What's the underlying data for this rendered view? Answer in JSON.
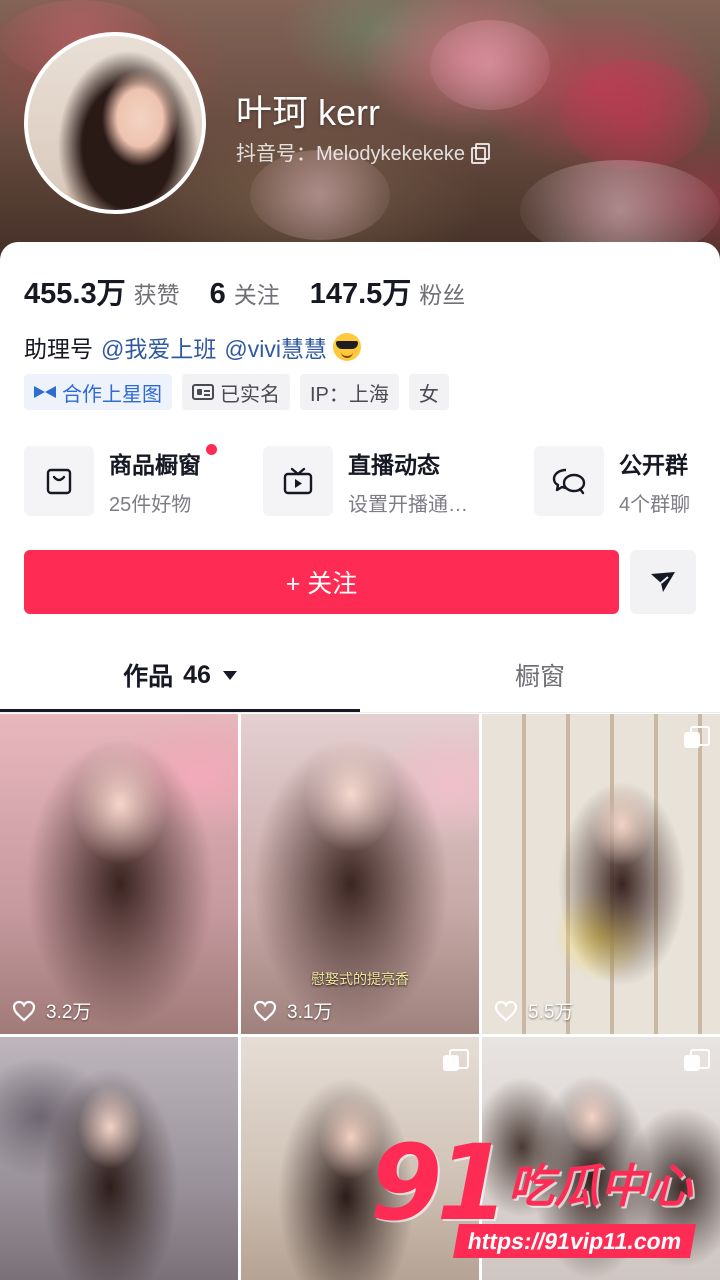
{
  "profile": {
    "name": "叶珂 kerr",
    "douyin_id": "抖音号：Melodykekekeke"
  },
  "stats": [
    {
      "value": "455.3万",
      "label": "获赞"
    },
    {
      "value": "6",
      "label": "关注"
    },
    {
      "value": "147.5万",
      "label": "粉丝"
    }
  ],
  "bio": {
    "prefix": "助理号",
    "mention1": "@我爱上班",
    "mention2": "@vivi慧慧"
  },
  "tags": {
    "star_map": "合作上星图",
    "verified": "已实名",
    "ip": "IP：上海",
    "gender": "女"
  },
  "shortcuts": [
    {
      "title": "商品橱窗",
      "sub": "25件好物",
      "icon": "shopping-bag-icon"
    },
    {
      "title": "直播动态",
      "sub": "设置开播通…",
      "icon": "tv-icon"
    },
    {
      "title": "公开群",
      "sub": "4个群聊",
      "icon": "group-chat-icon"
    }
  ],
  "actions": {
    "follow": "+ 关注"
  },
  "tabs": {
    "works_label": "作品",
    "works_count": "46",
    "shop_label": "橱窗"
  },
  "videos": [
    {
      "likes": "3.2万",
      "multi": false
    },
    {
      "likes": "3.1万",
      "multi": false,
      "caption": "慰娶式的提亮香"
    },
    {
      "likes": "5.5万",
      "multi": true
    },
    {
      "likes": "",
      "multi": false
    },
    {
      "likes": "",
      "multi": true
    },
    {
      "likes": "",
      "multi": true
    }
  ],
  "watermark": {
    "brand_num": "91",
    "brand_text": "吃瓜中心",
    "url": "https://91vip11.com"
  },
  "colors": {
    "accent": "#fe2c55",
    "mention": "#2f5aa0",
    "star_tag": "#2f6bd0"
  }
}
